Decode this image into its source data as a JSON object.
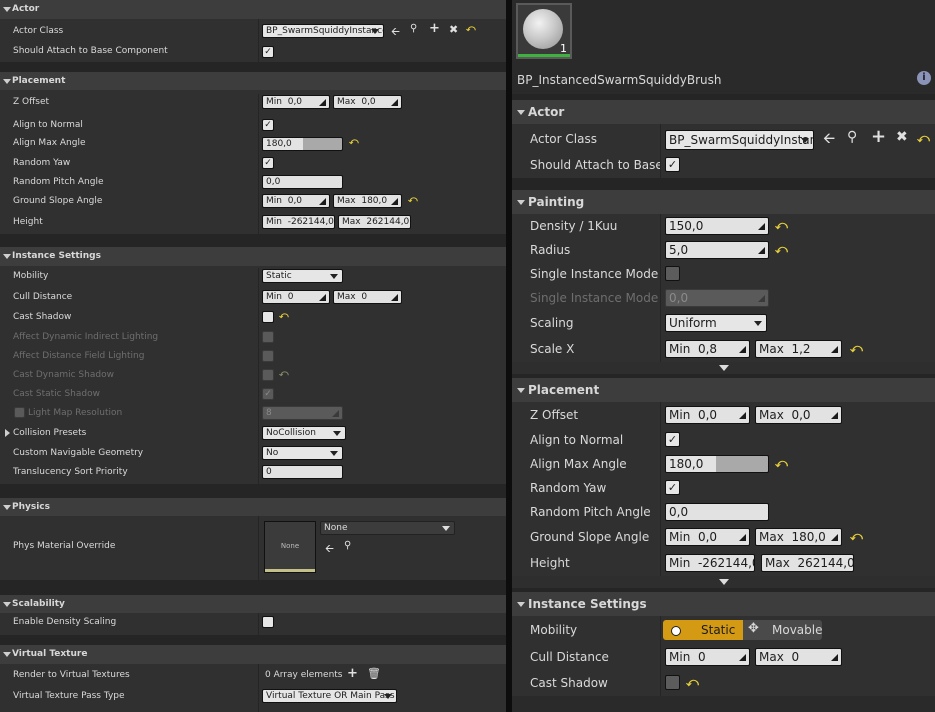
{
  "left": {
    "actor": {
      "title": "Actor",
      "actor_class_label": "Actor Class",
      "actor_class_value": "BP_SwarmSquiddyInstance",
      "attach_label": "Should Attach to Base Component"
    },
    "placement": {
      "title": "Placement",
      "z_offset_label": "Z Offset",
      "z_min": "0,0",
      "z_max": "0,0",
      "align_normal_label": "Align to Normal",
      "align_max_label": "Align Max Angle",
      "align_max_value": "180,0",
      "random_yaw_label": "Random Yaw",
      "random_pitch_label": "Random Pitch Angle",
      "random_pitch_value": "0,0",
      "ground_slope_label": "Ground Slope Angle",
      "ground_min": "0,0",
      "ground_max": "180,0",
      "height_label": "Height",
      "height_min": "-262144,0",
      "height_max": "262144,0"
    },
    "instance": {
      "title": "Instance Settings",
      "mobility_label": "Mobility",
      "mobility_value": "Static",
      "cull_label": "Cull Distance",
      "cull_min": "0",
      "cull_max": "0",
      "cast_shadow_label": "Cast Shadow",
      "adil_label": "Affect Dynamic Indirect Lighting",
      "adfl_label": "Affect Distance Field Lighting",
      "cds_label": "Cast Dynamic Shadow",
      "css_label": "Cast Static Shadow",
      "lmr_label": "Light Map Resolution",
      "lmr_value": "8",
      "collision_label": "Collision Presets",
      "collision_value": "NoCollision",
      "nav_label": "Custom Navigable Geometry",
      "nav_value": "No",
      "tsp_label": "Translucency Sort Priority",
      "tsp_value": "0"
    },
    "physics": {
      "title": "Physics",
      "pmo_label": "Phys Material Override",
      "thumb_text": "None",
      "pmo_value": "None"
    },
    "scalability": {
      "title": "Scalability",
      "eds_label": "Enable Density Scaling"
    },
    "vt": {
      "title": "Virtual Texture",
      "render_label": "Render to Virtual Textures",
      "render_value": "0 Array elements",
      "pass_label": "Virtual Texture Pass Type",
      "pass_value": "Virtual Texture OR Main Pass"
    }
  },
  "right": {
    "thumb_count": "1",
    "brush_name": "BP_InstancedSwarmSquiddyBrush",
    "actor": {
      "title": "Actor",
      "actor_class_label": "Actor Class",
      "actor_class_value": "BP_SwarmSquiddyInstanc",
      "attach_label": "Should Attach to Base Cor"
    },
    "painting": {
      "title": "Painting",
      "density_label": "Density / 1Kuu",
      "density_value": "150,0",
      "radius_label": "Radius",
      "radius_value": "5,0",
      "sim_over_label": "Single Instance Mode Ove",
      "sim_rad_label": "Single Instance Mode Rad",
      "sim_rad_value": "0,0",
      "scaling_label": "Scaling",
      "scaling_value": "Uniform",
      "scalex_label": "Scale X",
      "scalex_min": "0,8",
      "scalex_max": "1,2"
    },
    "placement": {
      "title": "Placement",
      "z_offset_label": "Z Offset",
      "z_min": "0,0",
      "z_max": "0,0",
      "align_normal_label": "Align to Normal",
      "align_max_label": "Align Max Angle",
      "align_max_value": "180,0",
      "random_yaw_label": "Random Yaw",
      "random_pitch_label": "Random Pitch Angle",
      "random_pitch_value": "0,0",
      "ground_slope_label": "Ground Slope Angle",
      "ground_min": "0,0",
      "ground_max": "180,0",
      "height_label": "Height",
      "height_min": "-262144,0",
      "height_max": "262144,0"
    },
    "instance": {
      "title": "Instance Settings",
      "mobility_label": "Mobility",
      "mobility_static": "Static",
      "mobility_movable": "Movable",
      "cull_label": "Cull Distance",
      "cull_min": "0",
      "cull_max": "0",
      "cast_shadow_label": "Cast Shadow"
    }
  },
  "common": {
    "min_label": "Min",
    "max_label": "Max",
    "check": "✓",
    "reset": "⤺"
  },
  "colors": {
    "panel": "#2f2f2f",
    "category": "#3d3d3d",
    "reset_arrow": "#e8d03a",
    "mobility_active": "#d49a14"
  }
}
